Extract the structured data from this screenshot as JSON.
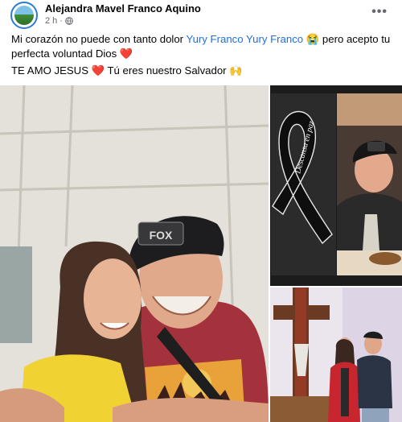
{
  "post": {
    "author": "Alejandra Mavel Franco Aquino",
    "time": "2 h",
    "separator": "·",
    "more_label": "•••",
    "text_part1": "Mi corazón no puede con tanto dolor ",
    "tag1": "Yury Franco",
    "tag2": "Yury Franco",
    "text_part2": " 😭 pero acepto tu perfecta voluntad Dios ❤️",
    "line2": "TE AMO JESUS ❤️ Tú eres nuestro Salvador 🙌"
  },
  "photos": {
    "main_cap_text": "FOX",
    "ribbon_text": "Descansa en paz"
  },
  "icons": {
    "globe": "globe-icon",
    "more": "more-options-icon"
  },
  "colors": {
    "tag": "#216fdb",
    "meta": "#65676b"
  }
}
